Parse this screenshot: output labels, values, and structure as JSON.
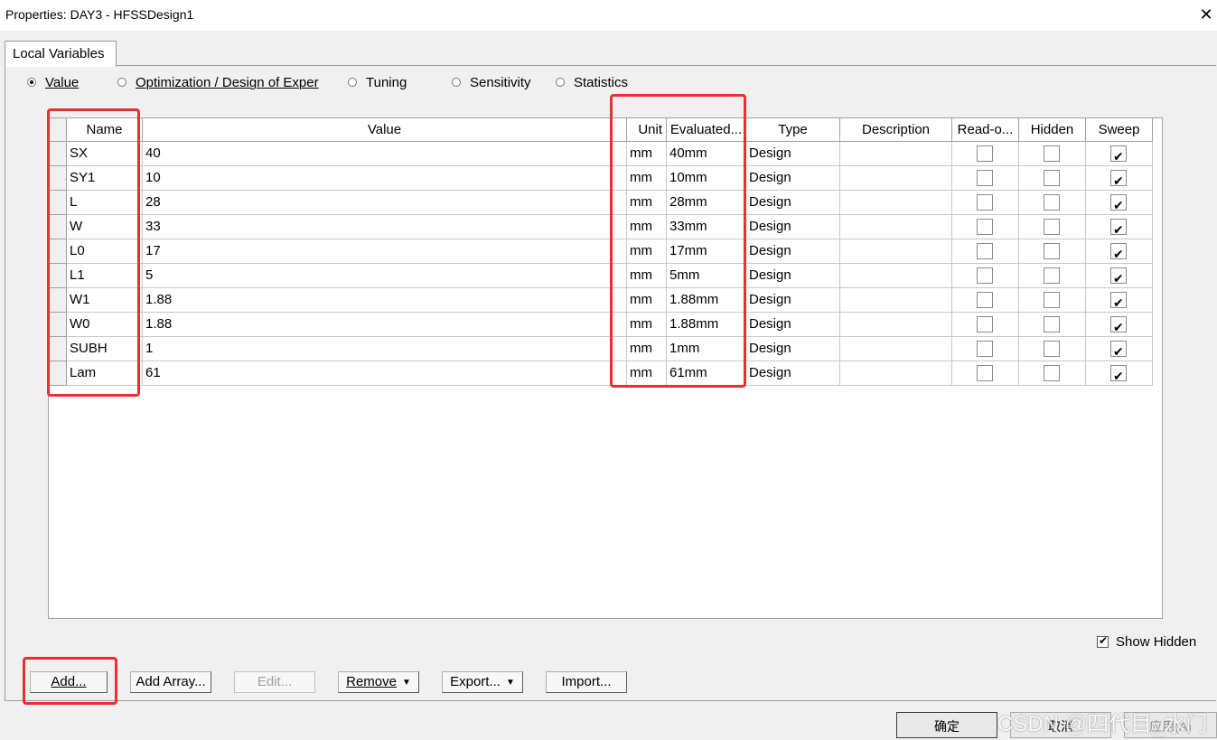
{
  "window": {
    "title": "Properties: DAY3 - HFSSDesign1",
    "close_label": "✕"
  },
  "tab": {
    "label": "Local Variables"
  },
  "radios": [
    {
      "label": "Value",
      "selected": true
    },
    {
      "label": "Optimization / Design of Exper",
      "selected": false
    },
    {
      "label": "Tuning",
      "selected": false
    },
    {
      "label": "Sensitivity",
      "selected": false
    },
    {
      "label": "Statistics",
      "selected": false
    }
  ],
  "table": {
    "columns": [
      "Name",
      "Value",
      "Unit",
      "Evaluated...",
      "Type",
      "Description",
      "Read-o...",
      "Hidden",
      "Sweep"
    ],
    "rows": [
      {
        "name": "SX",
        "value": "40",
        "unit": "mm",
        "evaluated": "40mm",
        "type": "Design",
        "description": "",
        "readonly": false,
        "hidden": false,
        "sweep": true
      },
      {
        "name": "SY1",
        "value": "10",
        "unit": "mm",
        "evaluated": "10mm",
        "type": "Design",
        "description": "",
        "readonly": false,
        "hidden": false,
        "sweep": true
      },
      {
        "name": "L",
        "value": "28",
        "unit": "mm",
        "evaluated": "28mm",
        "type": "Design",
        "description": "",
        "readonly": false,
        "hidden": false,
        "sweep": true
      },
      {
        "name": "W",
        "value": "33",
        "unit": "mm",
        "evaluated": "33mm",
        "type": "Design",
        "description": "",
        "readonly": false,
        "hidden": false,
        "sweep": true
      },
      {
        "name": "L0",
        "value": "17",
        "unit": "mm",
        "evaluated": "17mm",
        "type": "Design",
        "description": "",
        "readonly": false,
        "hidden": false,
        "sweep": true
      },
      {
        "name": "L1",
        "value": "5",
        "unit": "mm",
        "evaluated": "5mm",
        "type": "Design",
        "description": "",
        "readonly": false,
        "hidden": false,
        "sweep": true
      },
      {
        "name": "W1",
        "value": "1.88",
        "unit": "mm",
        "evaluated": "1.88mm",
        "type": "Design",
        "description": "",
        "readonly": false,
        "hidden": false,
        "sweep": true
      },
      {
        "name": "W0",
        "value": "1.88",
        "unit": "mm",
        "evaluated": "1.88mm",
        "type": "Design",
        "description": "",
        "readonly": false,
        "hidden": false,
        "sweep": true
      },
      {
        "name": "SUBH",
        "value": "1",
        "unit": "mm",
        "evaluated": "1mm",
        "type": "Design",
        "description": "",
        "readonly": false,
        "hidden": false,
        "sweep": true
      },
      {
        "name": "Lam",
        "value": "61",
        "unit": "mm",
        "evaluated": "61mm",
        "type": "Design",
        "description": "",
        "readonly": false,
        "hidden": false,
        "sweep": true
      }
    ]
  },
  "show_hidden": {
    "label": "Show Hidden",
    "checked": true
  },
  "buttons": {
    "add": "Add...",
    "add_array": "Add Array...",
    "edit": "Edit...",
    "remove": "Remove",
    "export": "Export...",
    "import": "Import..."
  },
  "dialog_buttons": {
    "ok": "确定",
    "cancel": "取消",
    "apply": "应用(A)"
  },
  "watermark": "CSDN @四代目_水门",
  "colors": {
    "highlight": "#e8312f"
  }
}
